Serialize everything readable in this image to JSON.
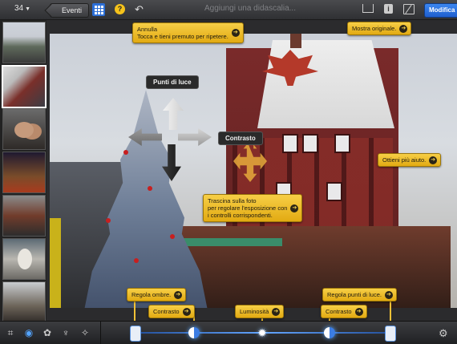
{
  "topbar": {
    "count": "34",
    "back_label": "Eventi",
    "help_label": "?",
    "caption_placeholder": "Aggiungi una didascalia...",
    "info_label": "i",
    "edit_label": "Modifica"
  },
  "thumbnails": [
    "thumb-1",
    "thumb-2",
    "thumb-3",
    "thumb-4",
    "thumb-5",
    "thumb-6",
    "thumb-7"
  ],
  "tips": {
    "annulla": {
      "line1": "Annulla",
      "line2": "Tocca e tieni premuto per ripetere."
    },
    "mostra_originale": "Mostra originale.",
    "ottieni_aiuto": "Ottieni più aiuto.",
    "trascina": {
      "line1": "Trascina sulla foto",
      "line2": "per regolare l'esposizione con",
      "line3": "i controlli corrispondenti."
    },
    "regola_ombre": "Regola ombre.",
    "regola_luce": "Regola punti di luce.",
    "contrasto_left": "Contrasto",
    "luminosita": "Luminosità",
    "contrasto_right": "Contrasto"
  },
  "photo_tags": {
    "punti_di_luce": "Punti di luce",
    "contrasto": "Contrasto"
  },
  "go_glyph": "➔",
  "colors": {
    "accent_blue": "#2d6fd6",
    "tip_yellow": "#f2c23a"
  }
}
